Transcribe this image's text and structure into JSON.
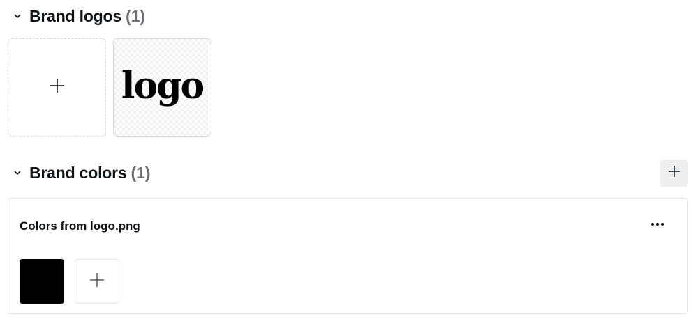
{
  "brand_logos": {
    "title": "Brand logos",
    "count": "(1)",
    "logos": [
      {
        "label": "logo"
      }
    ]
  },
  "brand_colors": {
    "title": "Brand colors",
    "count": "(1)",
    "palettes": [
      {
        "title": "Colors from logo.png",
        "colors": [
          "#000000"
        ]
      }
    ]
  },
  "icons": {
    "collapse": "chevron-down-icon",
    "add": "plus-icon",
    "more": "more-horizontal-icon"
  }
}
